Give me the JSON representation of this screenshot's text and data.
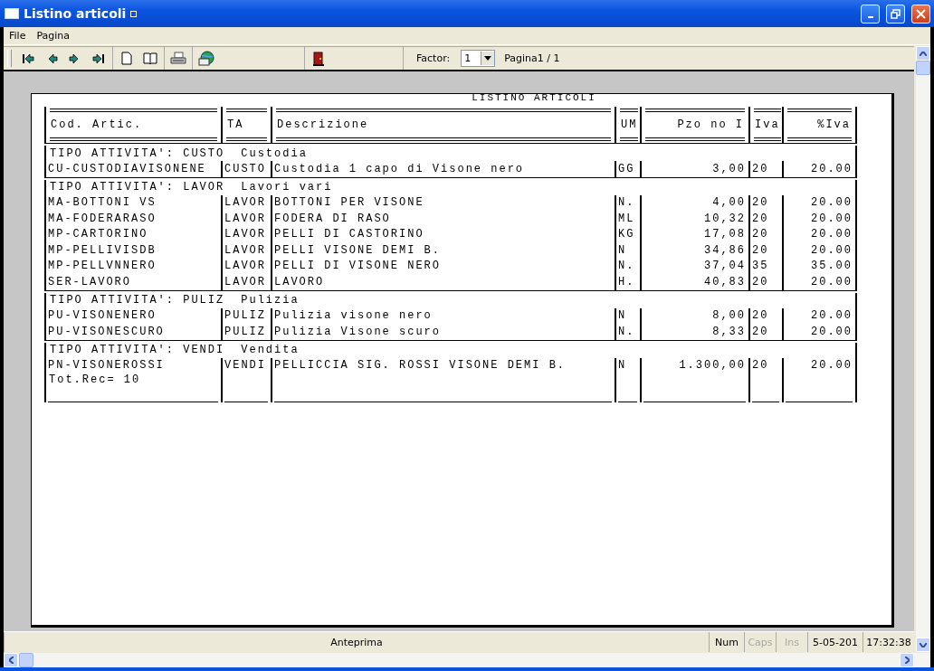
{
  "window": {
    "title": "Listino articoli"
  },
  "menu": [
    "File",
    "Pagina"
  ],
  "toolbar": {
    "factor_label": "Factor:",
    "factor_value": "1",
    "page_label": "Pagina1 / 1"
  },
  "report": {
    "title": "LISTINO ARTICOLI",
    "columns": [
      {
        "label": "Cod. Artic.",
        "kind": "text"
      },
      {
        "label": "TA",
        "kind": "text"
      },
      {
        "label": "Descrizione",
        "kind": "text"
      },
      {
        "label": "UM",
        "kind": "text"
      },
      {
        "label": "Pzo no I",
        "kind": "amount"
      },
      {
        "label": "Iva",
        "kind": "text"
      },
      {
        "label": "%Iva",
        "kind": "amount"
      }
    ],
    "groups": [
      {
        "code": "TIPO ATTIVITA': CUSTO",
        "name": "Custodia",
        "rows": [
          [
            "CU-CUSTODIAVISONENE",
            "CUSTO",
            "Custodia 1 capo di Visone nero",
            "GG",
            "3,00",
            "20",
            "20.00"
          ]
        ]
      },
      {
        "code": "TIPO ATTIVITA': LAVOR",
        "name": "Lavori vari",
        "rows": [
          [
            "MA-BOTTONI VS",
            "LAVOR",
            "BOTTONI PER VISONE",
            "N.",
            "4,00",
            "20",
            "20.00"
          ],
          [
            "MA-FODERARASO",
            "LAVOR",
            "FODERA DI RASO",
            "ML",
            "10,32",
            "20",
            "20.00"
          ],
          [
            "MP-CARTORINO",
            "LAVOR",
            "PELLI DI CASTORINO",
            "KG",
            "17,08",
            "20",
            "20.00"
          ],
          [
            "MP-PELLIVISDB",
            "LAVOR",
            "PELLI VISONE DEMI B.",
            "N",
            "34,86",
            "20",
            "20.00"
          ],
          [
            "MP-PELLVNNERO",
            "LAVOR",
            "PELLI DI VISONE NERO",
            "N.",
            "37,04",
            "35",
            "35.00"
          ],
          [
            "SER-LAVORO",
            "LAVOR",
            "LAVORO",
            "H.",
            "40,83",
            "20",
            "20.00"
          ]
        ]
      },
      {
        "code": "TIPO ATTIVITA': PULIZ",
        "name": "Pulizia",
        "rows": [
          [
            "PU-VISONENERO",
            "PULIZ",
            "Pulizia visone nero",
            "N",
            "8,00",
            "20",
            "20.00"
          ],
          [
            "PU-VISONESCURO",
            "PULIZ",
            "Pulizia Visone scuro",
            "N.",
            "8,33",
            "20",
            "20.00"
          ]
        ]
      },
      {
        "code": "TIPO ATTIVITA': VENDI",
        "name": "Vendita",
        "rows": [
          [
            "PN-VISONEROSSI",
            "VENDI",
            "PELLICCIA SIG. ROSSI VISONE DEMI B.",
            "N",
            "1.300,00",
            "20",
            "20.00"
          ]
        ]
      }
    ],
    "total": "Tot.Rec= 10"
  },
  "status_bar": {
    "message": "Anteprima",
    "indicators": [
      {
        "label": "Num",
        "on": true
      },
      {
        "label": "Caps",
        "on": false
      },
      {
        "label": "Ins",
        "on": false
      }
    ],
    "date": "5-05-201",
    "time": "17:32:38"
  }
}
